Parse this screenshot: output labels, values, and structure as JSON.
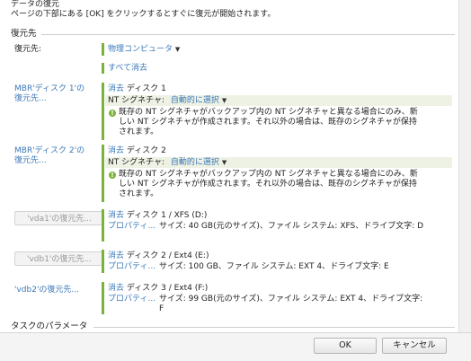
{
  "header": {
    "title": "データの復元",
    "subtitle": "ページの下部にある [OK] をクリックするとすぐに復元が開始されます。"
  },
  "restore_to": {
    "section_label": "復元先",
    "label": "復元先:",
    "value": "物理コンピュータ",
    "clear_all": "すべて消去"
  },
  "mbr1": {
    "label": "MBR'ディスク 1'の\n復元先...",
    "clear": "消去",
    "disk": "ディスク 1",
    "nt_label": "NT シグネチャ:",
    "nt_value": "自動的に選択",
    "note": "既存の NT シグネチャがバックアップ内の NT シグネチャと異なる場合にのみ、新しい NT シグネチャが作成されます。それ以外の場合は、既存のシグネチャが保持されます。"
  },
  "mbr2": {
    "label": "MBR'ディスク 2'の\n復元先...",
    "clear": "消去",
    "disk": "ディスク 2",
    "nt_label": "NT シグネチャ:",
    "nt_value": "自動的に選択",
    "note": "既存の NT シグネチャがバックアップ内の NT シグネチャと異なる場合にのみ、新しい NT シグネチャが作成されます。それ以外の場合は、既存のシグネチャが保持されます。"
  },
  "vda1": {
    "button": "'vda1'の復元先...",
    "clear": "消去",
    "disk": "ディスク 1 / XFS (D:)",
    "properties": "プロパティ...",
    "desc": "サイズ: 40 GB(元のサイズ)、ファイル システム: XFS、ドライブ文字: D"
  },
  "vdb1": {
    "button": "'vdb1'の復元先...",
    "clear": "消去",
    "disk": "ディスク 2 / Ext4 (E:)",
    "properties": "プロパティ...",
    "desc": "サイズ: 100 GB、ファイル システム: EXT 4、ドライブ文字: E"
  },
  "vdb2": {
    "link": "'vdb2'の復元先...",
    "clear": "消去",
    "disk": "ディスク 3 / Ext4 (F:)",
    "properties": "プロパティ...",
    "desc": "サイズ: 99 GB(元のサイズ)、ファイル システム: EXT 4、ドライブ文字: F"
  },
  "task_params": {
    "section_label": "タスクのパラメータ"
  },
  "footer": {
    "ok": "OK",
    "cancel": "キャンセル"
  }
}
